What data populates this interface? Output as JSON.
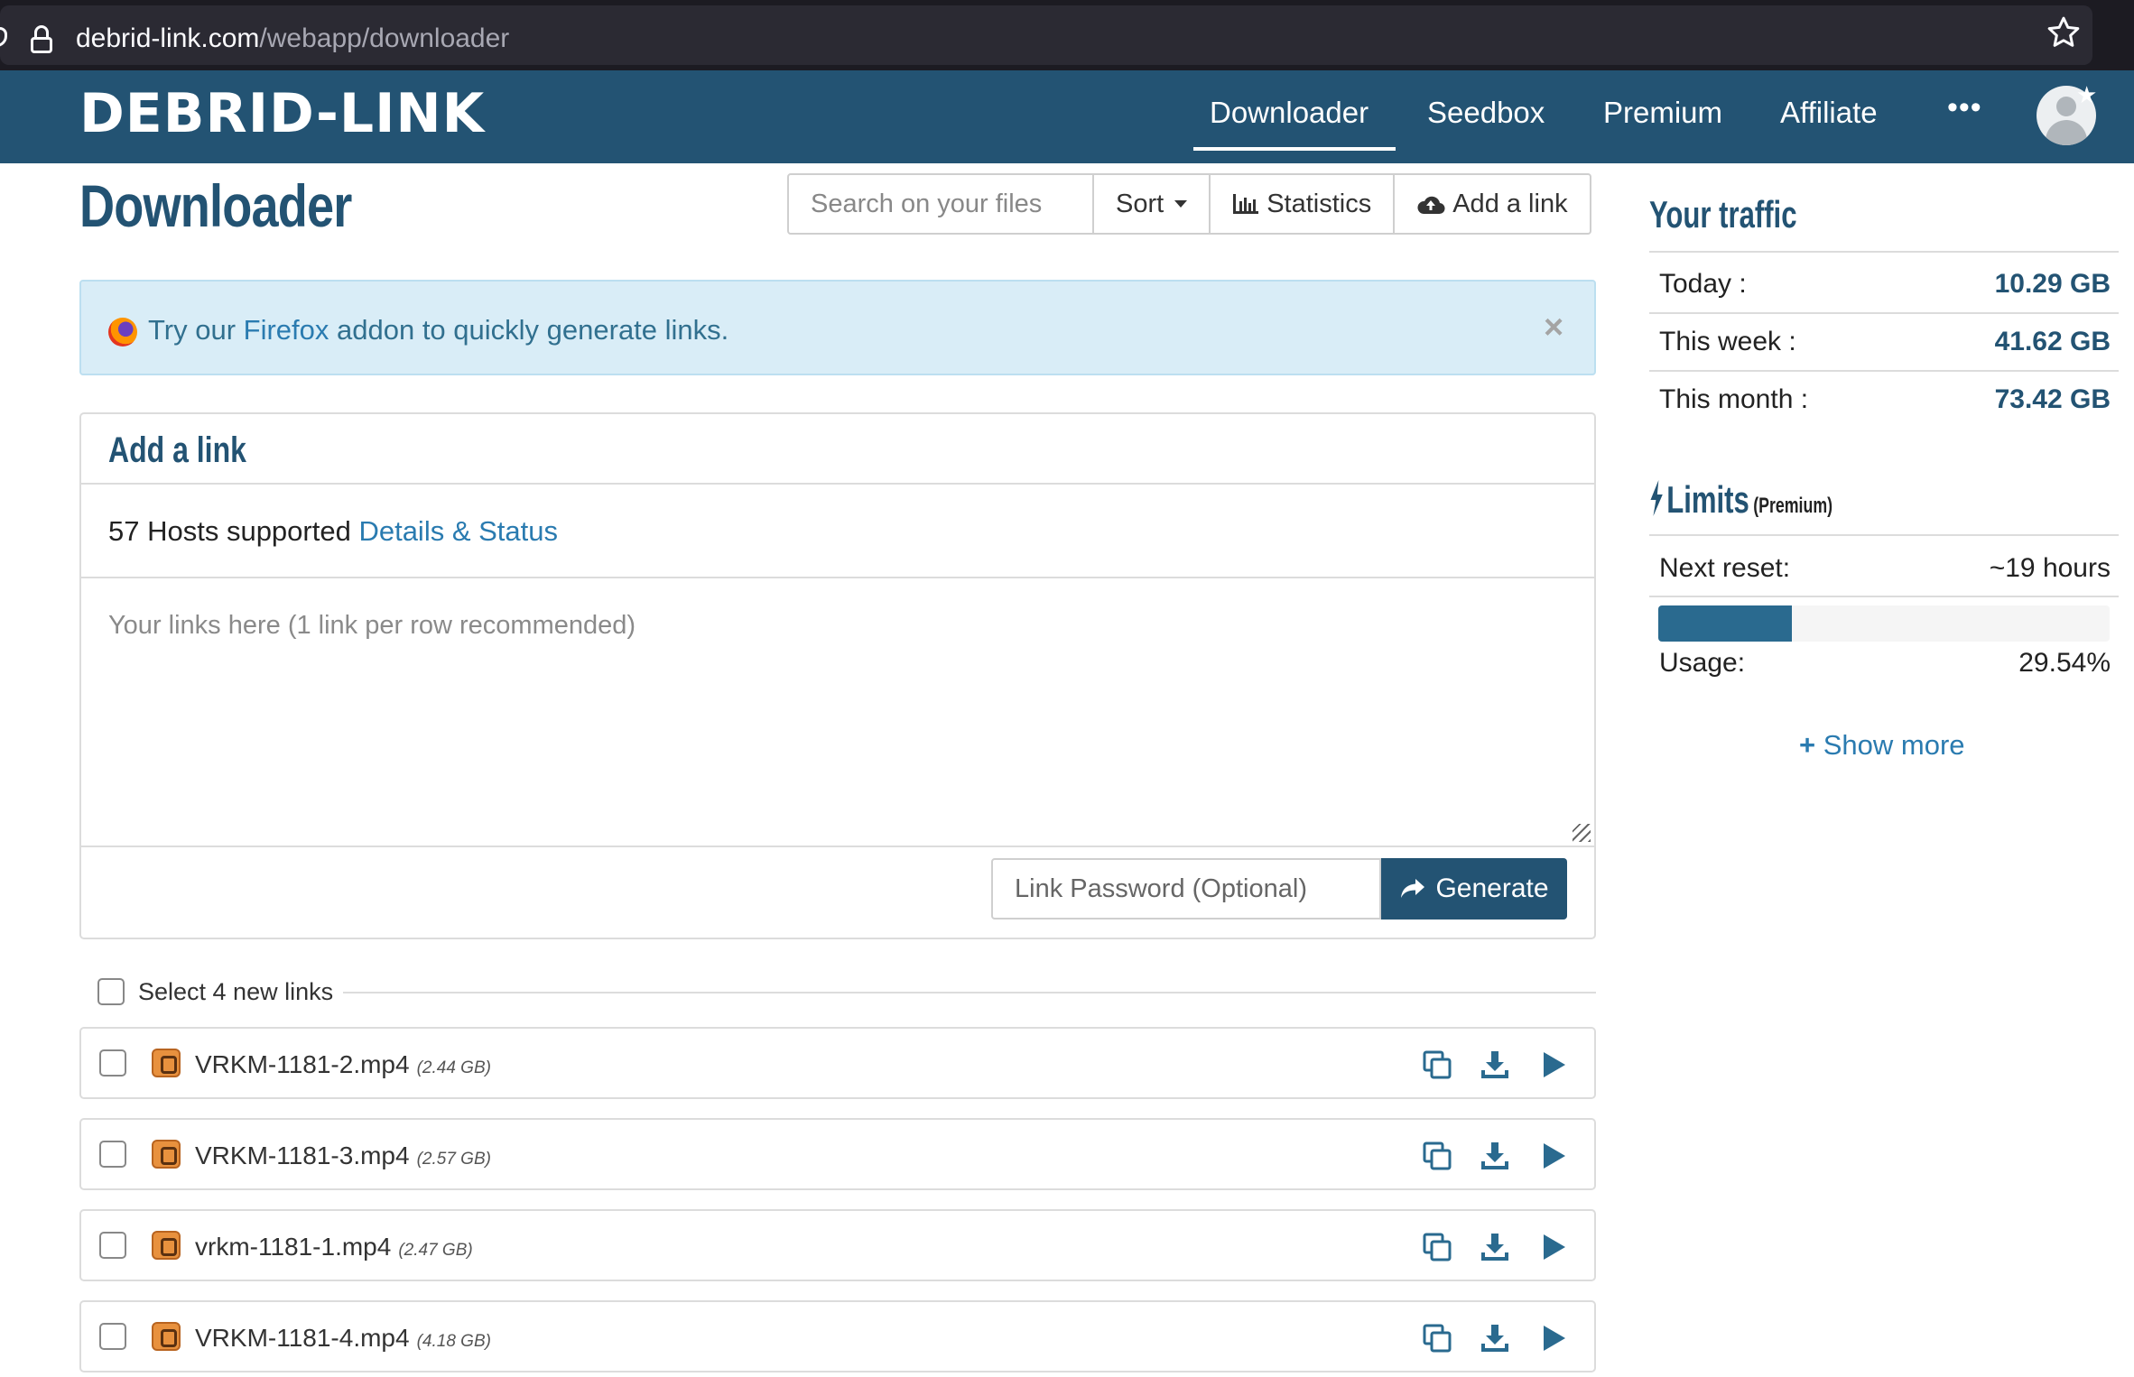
{
  "browser": {
    "url_domain": "debrid-link.com",
    "url_path": "/webapp/downloader"
  },
  "header": {
    "logo": "DEBRID-LINK",
    "nav": [
      {
        "label": "Downloader",
        "active": true
      },
      {
        "label": "Seedbox"
      },
      {
        "label": "Premium"
      },
      {
        "label": "Affiliate"
      }
    ],
    "more_label": "•••"
  },
  "page": {
    "title": "Downloader"
  },
  "toolbar": {
    "search_placeholder": "Search on your files",
    "sort_label": "Sort",
    "statistics_label": "Statistics",
    "add_link_label": "Add a link"
  },
  "alert": {
    "text_before": "Try our ",
    "link_text": "Firefox",
    "text_after": " addon to quickly generate links.",
    "close_label": "×"
  },
  "add_link_panel": {
    "title": "Add a link",
    "hosts_text": "57 Hosts supported ",
    "hosts_link": "Details & Status",
    "textarea_placeholder": "Your links here (1 link per row recommended)",
    "password_placeholder": "Link Password (Optional)",
    "generate_label": "Generate"
  },
  "file_list": {
    "select_label": "Select 4 new links",
    "files": [
      {
        "name": "VRKM-1181-2.mp4",
        "size": "(2.44 GB)"
      },
      {
        "name": "VRKM-1181-3.mp4",
        "size": "(2.57 GB)"
      },
      {
        "name": "vrkm-1181-1.mp4",
        "size": "(2.47 GB)"
      },
      {
        "name": "VRKM-1181-4.mp4",
        "size": "(4.18 GB)"
      }
    ]
  },
  "traffic": {
    "title": "Your traffic",
    "rows": [
      {
        "label": "Today :",
        "value": "10.29 GB"
      },
      {
        "label": "This week :",
        "value": "41.62 GB"
      },
      {
        "label": "This month :",
        "value": "73.42 GB"
      }
    ]
  },
  "limits": {
    "title": "Limits",
    "subtitle": "(Premium)",
    "next_reset_label": "Next reset:",
    "next_reset_value": "~19 hours",
    "usage_label": "Usage:",
    "usage_value": "29.54%",
    "usage_fraction": 0.2954,
    "show_more_label": "Show more"
  },
  "colors": {
    "brand": "#235373",
    "link": "#2a7bb0",
    "alert_bg": "#d9edf7"
  }
}
